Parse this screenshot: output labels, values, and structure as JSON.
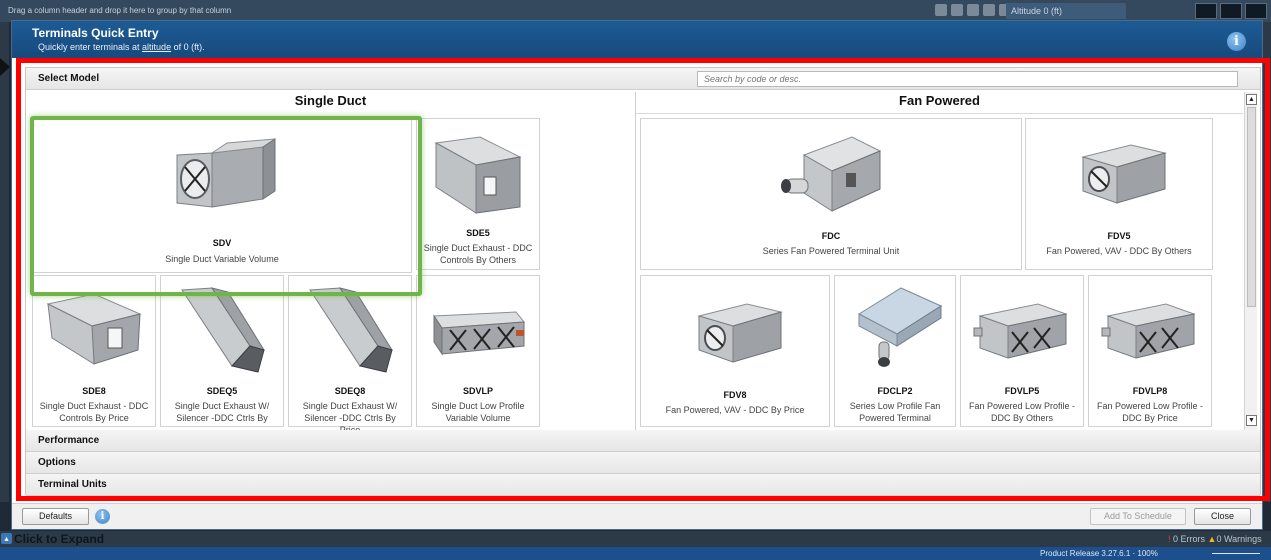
{
  "background": {
    "top_hint": "Drag a column header and drop it here to group by that column",
    "altitude_label": "Altitude 0 (ft)",
    "expand_label": "Click to Expand",
    "errors": "0 Errors",
    "warnings": "0 Warnings",
    "status": "Product Release 3.27.6.1 · 100%"
  },
  "dialog": {
    "title": "Terminals Quick Entry",
    "subtitle_prefix": "Quickly enter terminals at ",
    "subtitle_link": "altitude",
    "subtitle_suffix": " of 0 (ft).",
    "info_glyph": "i"
  },
  "sections": {
    "select_model": "Select Model",
    "performance": "Performance",
    "options": "Options",
    "terminal_units": "Terminal Units"
  },
  "search": {
    "placeholder": "Search by code or desc."
  },
  "groups": {
    "single_duct": "Single Duct",
    "fan_powered": "Fan Powered"
  },
  "single_duct_tiles": [
    {
      "code": "SDV",
      "desc": "Single Duct Variable Volume",
      "icon": "single-duct-box-icon",
      "selected": true
    },
    {
      "code": "SDE5",
      "desc": "Single Duct Exhaust - DDC Controls By Others",
      "icon": "single-duct-exhaust-icon"
    },
    {
      "code": "SDE8",
      "desc": "Single Duct Exhaust - DDC Controls By Price",
      "icon": "single-duct-exhaust-icon"
    },
    {
      "code": "SDEQ5",
      "desc": "Single Duct Exhaust W/ Silencer -DDC Ctrls By",
      "icon": "single-duct-silencer-icon"
    },
    {
      "code": "SDEQ8",
      "desc": "Single Duct Exhaust W/ Silencer -DDC Ctrls By Price",
      "icon": "single-duct-silencer-icon"
    },
    {
      "code": "SDVLP",
      "desc": "Single Duct Low Profile Variable Volume",
      "icon": "low-profile-duct-icon"
    }
  ],
  "fan_powered_tiles": [
    {
      "code": "FDC",
      "desc": "Series Fan Powered Terminal Unit",
      "icon": "fan-powered-unit-icon"
    },
    {
      "code": "FDV5",
      "desc": "Fan Powered, VAV - DDC By Others",
      "icon": "fan-powered-vav-icon"
    },
    {
      "code": "FDV8",
      "desc": "Fan Powered, VAV - DDC By Price",
      "icon": "fan-powered-vav-icon"
    },
    {
      "code": "FDCLP2",
      "desc": "Series Low Profile Fan Powered Terminal",
      "icon": "low-profile-fan-icon"
    },
    {
      "code": "FDVLP5",
      "desc": "Fan Powered Low Profile - DDC By Others",
      "icon": "fan-low-profile-icon"
    },
    {
      "code": "FDVLP8",
      "desc": "Fan Powered Low Profile - DDC By Price",
      "icon": "fan-low-profile-icon"
    }
  ],
  "footer": {
    "defaults_button": "Defaults",
    "add_button": "Add To Schedule",
    "close_button": "Close",
    "help_glyph": "i"
  },
  "colors": {
    "header_blue": "#1d5b95",
    "highlight_red": "#ff0000",
    "selection_green": "#70b54a"
  }
}
